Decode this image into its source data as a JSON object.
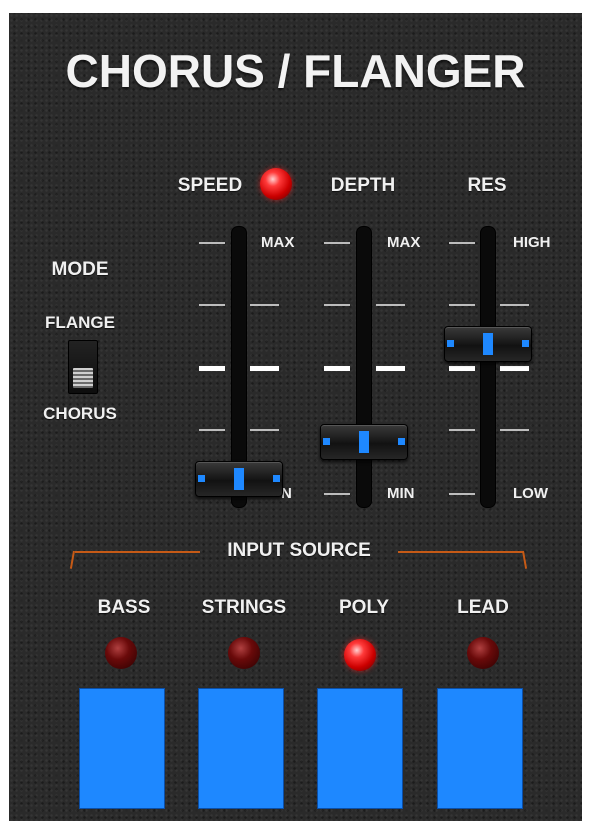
{
  "title": "CHORUS / FLANGER",
  "mode": {
    "label": "MODE",
    "upper": "FLANGE",
    "lower": "CHORUS",
    "position": "CHORUS"
  },
  "speed": {
    "label": "SPEED",
    "max": "MAX",
    "min": "N",
    "level": 0.05,
    "led_on": true
  },
  "depth": {
    "label": "DEPTH",
    "max": "MAX",
    "min": "MIN",
    "level": 0.2
  },
  "res": {
    "label": "RES",
    "max": "HIGH",
    "min": "LOW",
    "level": 0.6
  },
  "input_source": {
    "label": "INPUT SOURCE",
    "sources": [
      {
        "label": "BASS",
        "active": false
      },
      {
        "label": "STRINGS",
        "active": false
      },
      {
        "label": "POLY",
        "active": true
      },
      {
        "label": "LEAD",
        "active": false
      }
    ]
  },
  "colors": {
    "accent": "#1e88ff",
    "led_on": "#ff2a2a",
    "bracket": "#c65a16",
    "panel": "#2a2a2a"
  }
}
